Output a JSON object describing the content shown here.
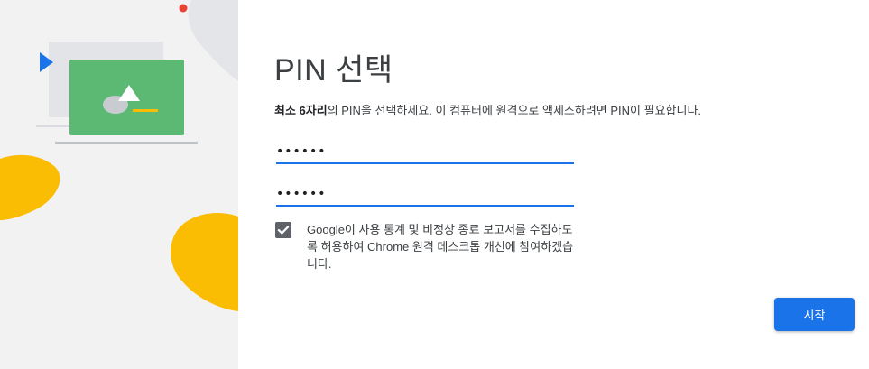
{
  "page": {
    "title": "PIN 선택",
    "description_bold": "최소 6자리",
    "description_rest": "의 PIN을 선택하세요. 이 컴퓨터에 원격으로 액세스하려면 PIN이 필요합니다."
  },
  "form": {
    "pin_value": "••••••",
    "pin_confirm_value": "••••••",
    "consent_checked": true,
    "consent_text": "Google이 사용 통계 및 비정상 종료 보고서를 수집하도록 허용하여 Chrome 원격 데스크톱 개선에 참여하겠습니다."
  },
  "actions": {
    "start_label": "시작"
  },
  "colors": {
    "accent": "#1a73e8",
    "illustration_green": "#5bb974",
    "illustration_yellow": "#fbbc04",
    "illustration_red": "#ea4335"
  }
}
